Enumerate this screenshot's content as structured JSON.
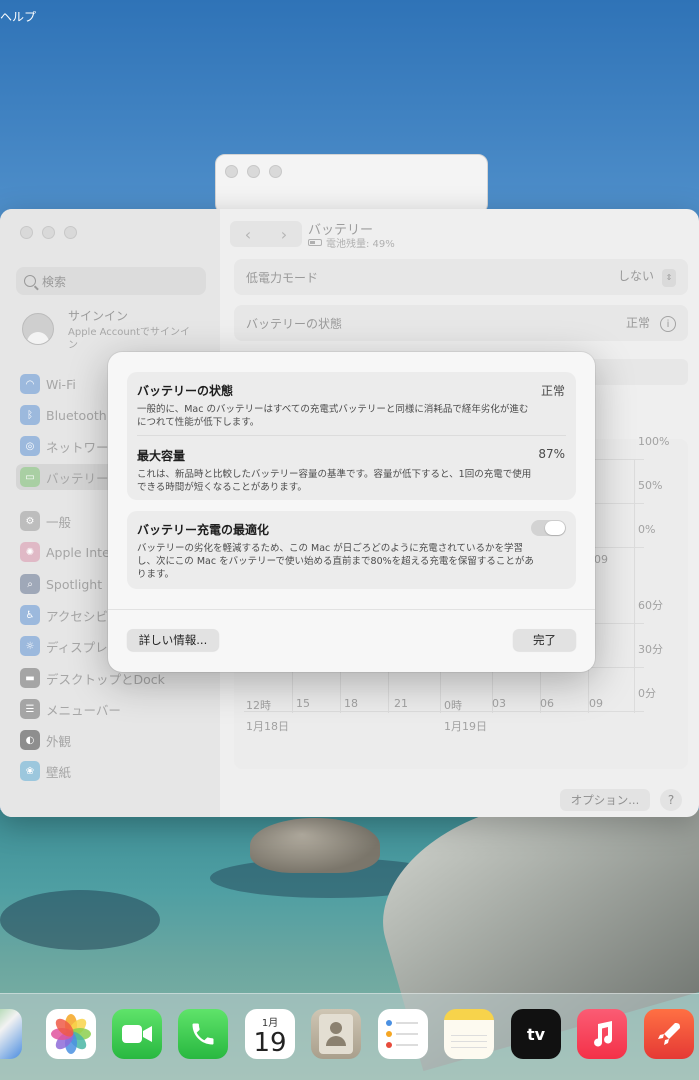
{
  "menubar": {
    "help_label": "ヘルプ"
  },
  "settings_window": {
    "sidebar": {
      "search_placeholder": "検索",
      "signin_title": "サインイン",
      "signin_subtitle": "Apple Accountでサインイン",
      "items": [
        {
          "label": "Wi-Fi",
          "icon": "wifi-icon"
        },
        {
          "label": "Bluetooth",
          "icon": "bluetooth-icon"
        },
        {
          "label": "ネットワーク",
          "icon": "network-icon"
        },
        {
          "label": "バッテリー",
          "icon": "battery-icon"
        },
        {
          "label": "一般",
          "icon": "gear-icon"
        },
        {
          "label": "Apple Intelligence",
          "icon": "apple-intelligence-icon"
        },
        {
          "label": "Spotlight",
          "icon": "spotlight-icon"
        },
        {
          "label": "アクセシビリティ",
          "icon": "accessibility-icon"
        },
        {
          "label": "ディスプレイ",
          "icon": "display-icon"
        },
        {
          "label": "デスクトップとDock",
          "icon": "dock-icon"
        },
        {
          "label": "メニューバー",
          "icon": "menubar-icon"
        },
        {
          "label": "外観",
          "icon": "appearance-icon"
        },
        {
          "label": "壁紙",
          "icon": "wallpaper-icon"
        }
      ]
    },
    "main": {
      "title": "バッテリー",
      "subtitle": "電池残量: 49%",
      "low_power_label": "低電力モード",
      "low_power_value": "しない",
      "battery_health_label": "バッテリーの状態",
      "battery_health_value": "正常",
      "chart_y_labels_top": [
        "100%",
        "50%",
        "0%"
      ],
      "chart_y_labels_bottom": [
        "60分",
        "30分",
        "0分"
      ],
      "chart_x_labels": [
        "12時",
        "15",
        "18",
        "21",
        "0時",
        "03",
        "06",
        "09"
      ],
      "chart_dates": [
        "1月18日",
        "1月19日"
      ],
      "chart_top_tick": "09",
      "options_button": "オプション...",
      "help_button": "?"
    }
  },
  "dialog": {
    "health_title": "バッテリーの状態",
    "health_value": "正常",
    "health_desc": "一般的に、Mac のバッテリーはすべての充電式バッテリーと同様に消耗品で経年劣化が進むにつれて性能が低下します。",
    "capacity_title": "最大容量",
    "capacity_value": "87%",
    "capacity_desc": "これは、新品時と比較したバッテリー容量の基準です。容量が低下すると、1回の充電で使用できる時間が短くなることがあります。",
    "optimize_title": "バッテリー充電の最適化",
    "optimize_desc": "バッテリーの劣化を軽減するため、この Mac が日ごろどのように充電されているかを学習し、次にこの Mac をバッテリーで使い始める直前まで80%を超える充電を保留することがあります。",
    "optimize_enabled": false,
    "more_info_button": "詳しい情報...",
    "done_button": "完了"
  },
  "dock": {
    "calendar_month": "月",
    "calendar_month_num": "1",
    "calendar_day": "19",
    "tv_label": "tv"
  }
}
